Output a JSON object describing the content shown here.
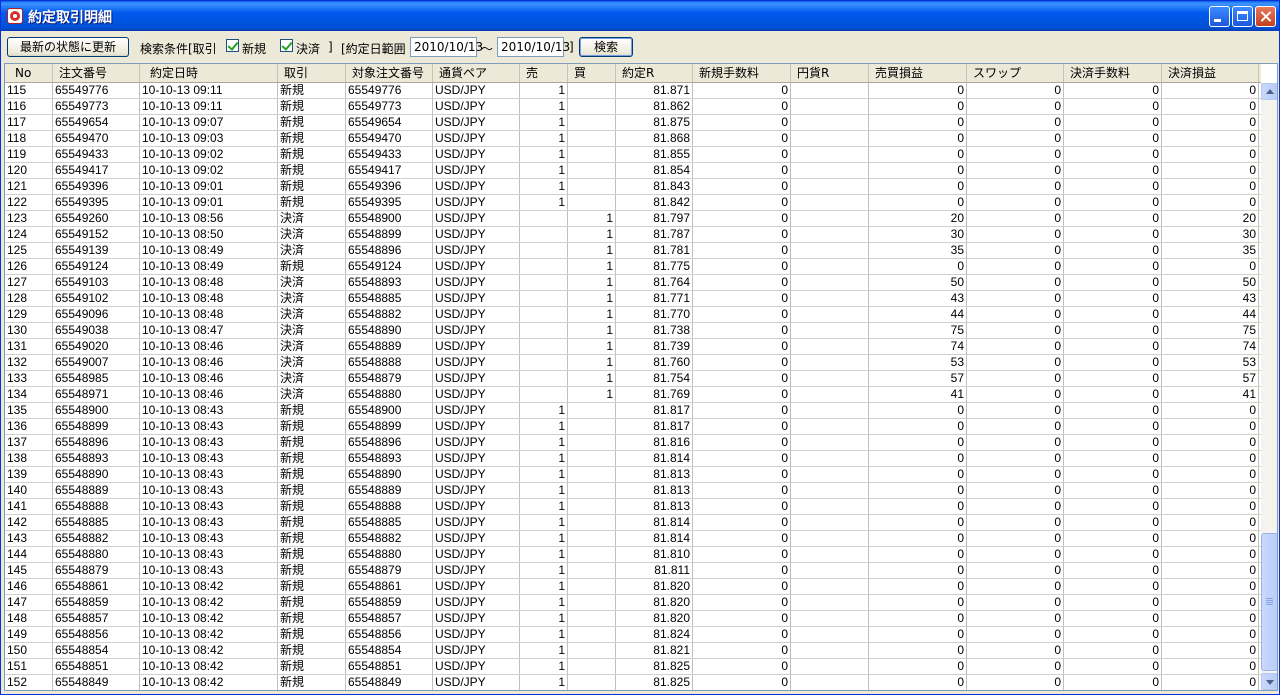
{
  "window": {
    "title": "約定取引明細"
  },
  "toolbar": {
    "refresh_label": "最新の状態に更新",
    "search_cond_label": "検索条件[取引",
    "new_label": "新規",
    "settle_label": "決済",
    "bracket_close": "]",
    "date_range_label": "[約定日範囲",
    "date_from": "2010/10/13",
    "tilde": "～",
    "date_to": "2010/10/13",
    "bracket_close2": "]",
    "search_label": "検索"
  },
  "table": {
    "columns": [
      "No",
      "注文番号",
      "約定日時",
      "取引",
      "対象注文番号",
      "通貨ペア",
      "売",
      "買",
      "約定R",
      "新規手数料",
      "円貨R",
      "売買損益",
      "スワップ",
      "決済手数料",
      "決済損益"
    ],
    "rows": [
      [
        "115",
        "65549776",
        "10-10-13 09:11",
        "新規",
        "65549776",
        "USD/JPY",
        "1",
        "",
        "81.871",
        "0",
        "",
        "0",
        "0",
        "0",
        "0"
      ],
      [
        "116",
        "65549773",
        "10-10-13 09:11",
        "新規",
        "65549773",
        "USD/JPY",
        "1",
        "",
        "81.862",
        "0",
        "",
        "0",
        "0",
        "0",
        "0"
      ],
      [
        "117",
        "65549654",
        "10-10-13 09:07",
        "新規",
        "65549654",
        "USD/JPY",
        "1",
        "",
        "81.875",
        "0",
        "",
        "0",
        "0",
        "0",
        "0"
      ],
      [
        "118",
        "65549470",
        "10-10-13 09:03",
        "新規",
        "65549470",
        "USD/JPY",
        "1",
        "",
        "81.868",
        "0",
        "",
        "0",
        "0",
        "0",
        "0"
      ],
      [
        "119",
        "65549433",
        "10-10-13 09:02",
        "新規",
        "65549433",
        "USD/JPY",
        "1",
        "",
        "81.855",
        "0",
        "",
        "0",
        "0",
        "0",
        "0"
      ],
      [
        "120",
        "65549417",
        "10-10-13 09:02",
        "新規",
        "65549417",
        "USD/JPY",
        "1",
        "",
        "81.854",
        "0",
        "",
        "0",
        "0",
        "0",
        "0"
      ],
      [
        "121",
        "65549396",
        "10-10-13 09:01",
        "新規",
        "65549396",
        "USD/JPY",
        "1",
        "",
        "81.843",
        "0",
        "",
        "0",
        "0",
        "0",
        "0"
      ],
      [
        "122",
        "65549395",
        "10-10-13 09:01",
        "新規",
        "65549395",
        "USD/JPY",
        "1",
        "",
        "81.842",
        "0",
        "",
        "0",
        "0",
        "0",
        "0"
      ],
      [
        "123",
        "65549260",
        "10-10-13 08:56",
        "決済",
        "65548900",
        "USD/JPY",
        "",
        "1",
        "81.797",
        "0",
        "",
        "20",
        "0",
        "0",
        "20"
      ],
      [
        "124",
        "65549152",
        "10-10-13 08:50",
        "決済",
        "65548899",
        "USD/JPY",
        "",
        "1",
        "81.787",
        "0",
        "",
        "30",
        "0",
        "0",
        "30"
      ],
      [
        "125",
        "65549139",
        "10-10-13 08:49",
        "決済",
        "65548896",
        "USD/JPY",
        "",
        "1",
        "81.781",
        "0",
        "",
        "35",
        "0",
        "0",
        "35"
      ],
      [
        "126",
        "65549124",
        "10-10-13 08:49",
        "新規",
        "65549124",
        "USD/JPY",
        "",
        "1",
        "81.775",
        "0",
        "",
        "0",
        "0",
        "0",
        "0"
      ],
      [
        "127",
        "65549103",
        "10-10-13 08:48",
        "決済",
        "65548893",
        "USD/JPY",
        "",
        "1",
        "81.764",
        "0",
        "",
        "50",
        "0",
        "0",
        "50"
      ],
      [
        "128",
        "65549102",
        "10-10-13 08:48",
        "決済",
        "65548885",
        "USD/JPY",
        "",
        "1",
        "81.771",
        "0",
        "",
        "43",
        "0",
        "0",
        "43"
      ],
      [
        "129",
        "65549096",
        "10-10-13 08:48",
        "決済",
        "65548882",
        "USD/JPY",
        "",
        "1",
        "81.770",
        "0",
        "",
        "44",
        "0",
        "0",
        "44"
      ],
      [
        "130",
        "65549038",
        "10-10-13 08:47",
        "決済",
        "65548890",
        "USD/JPY",
        "",
        "1",
        "81.738",
        "0",
        "",
        "75",
        "0",
        "0",
        "75"
      ],
      [
        "131",
        "65549020",
        "10-10-13 08:46",
        "決済",
        "65548889",
        "USD/JPY",
        "",
        "1",
        "81.739",
        "0",
        "",
        "74",
        "0",
        "0",
        "74"
      ],
      [
        "132",
        "65549007",
        "10-10-13 08:46",
        "決済",
        "65548888",
        "USD/JPY",
        "",
        "1",
        "81.760",
        "0",
        "",
        "53",
        "0",
        "0",
        "53"
      ],
      [
        "133",
        "65548985",
        "10-10-13 08:46",
        "決済",
        "65548879",
        "USD/JPY",
        "",
        "1",
        "81.754",
        "0",
        "",
        "57",
        "0",
        "0",
        "57"
      ],
      [
        "134",
        "65548971",
        "10-10-13 08:46",
        "決済",
        "65548880",
        "USD/JPY",
        "",
        "1",
        "81.769",
        "0",
        "",
        "41",
        "0",
        "0",
        "41"
      ],
      [
        "135",
        "65548900",
        "10-10-13 08:43",
        "新規",
        "65548900",
        "USD/JPY",
        "1",
        "",
        "81.817",
        "0",
        "",
        "0",
        "0",
        "0",
        "0"
      ],
      [
        "136",
        "65548899",
        "10-10-13 08:43",
        "新規",
        "65548899",
        "USD/JPY",
        "1",
        "",
        "81.817",
        "0",
        "",
        "0",
        "0",
        "0",
        "0"
      ],
      [
        "137",
        "65548896",
        "10-10-13 08:43",
        "新規",
        "65548896",
        "USD/JPY",
        "1",
        "",
        "81.816",
        "0",
        "",
        "0",
        "0",
        "0",
        "0"
      ],
      [
        "138",
        "65548893",
        "10-10-13 08:43",
        "新規",
        "65548893",
        "USD/JPY",
        "1",
        "",
        "81.814",
        "0",
        "",
        "0",
        "0",
        "0",
        "0"
      ],
      [
        "139",
        "65548890",
        "10-10-13 08:43",
        "新規",
        "65548890",
        "USD/JPY",
        "1",
        "",
        "81.813",
        "0",
        "",
        "0",
        "0",
        "0",
        "0"
      ],
      [
        "140",
        "65548889",
        "10-10-13 08:43",
        "新規",
        "65548889",
        "USD/JPY",
        "1",
        "",
        "81.813",
        "0",
        "",
        "0",
        "0",
        "0",
        "0"
      ],
      [
        "141",
        "65548888",
        "10-10-13 08:43",
        "新規",
        "65548888",
        "USD/JPY",
        "1",
        "",
        "81.813",
        "0",
        "",
        "0",
        "0",
        "0",
        "0"
      ],
      [
        "142",
        "65548885",
        "10-10-13 08:43",
        "新規",
        "65548885",
        "USD/JPY",
        "1",
        "",
        "81.814",
        "0",
        "",
        "0",
        "0",
        "0",
        "0"
      ],
      [
        "143",
        "65548882",
        "10-10-13 08:43",
        "新規",
        "65548882",
        "USD/JPY",
        "1",
        "",
        "81.814",
        "0",
        "",
        "0",
        "0",
        "0",
        "0"
      ],
      [
        "144",
        "65548880",
        "10-10-13 08:43",
        "新規",
        "65548880",
        "USD/JPY",
        "1",
        "",
        "81.810",
        "0",
        "",
        "0",
        "0",
        "0",
        "0"
      ],
      [
        "145",
        "65548879",
        "10-10-13 08:43",
        "新規",
        "65548879",
        "USD/JPY",
        "1",
        "",
        "81.811",
        "0",
        "",
        "0",
        "0",
        "0",
        "0"
      ],
      [
        "146",
        "65548861",
        "10-10-13 08:42",
        "新規",
        "65548861",
        "USD/JPY",
        "1",
        "",
        "81.820",
        "0",
        "",
        "0",
        "0",
        "0",
        "0"
      ],
      [
        "147",
        "65548859",
        "10-10-13 08:42",
        "新規",
        "65548859",
        "USD/JPY",
        "1",
        "",
        "81.820",
        "0",
        "",
        "0",
        "0",
        "0",
        "0"
      ],
      [
        "148",
        "65548857",
        "10-10-13 08:42",
        "新規",
        "65548857",
        "USD/JPY",
        "1",
        "",
        "81.820",
        "0",
        "",
        "0",
        "0",
        "0",
        "0"
      ],
      [
        "149",
        "65548856",
        "10-10-13 08:42",
        "新規",
        "65548856",
        "USD/JPY",
        "1",
        "",
        "81.824",
        "0",
        "",
        "0",
        "0",
        "0",
        "0"
      ],
      [
        "150",
        "65548854",
        "10-10-13 08:42",
        "新規",
        "65548854",
        "USD/JPY",
        "1",
        "",
        "81.821",
        "0",
        "",
        "0",
        "0",
        "0",
        "0"
      ],
      [
        "151",
        "65548851",
        "10-10-13 08:42",
        "新規",
        "65548851",
        "USD/JPY",
        "1",
        "",
        "81.825",
        "0",
        "",
        "0",
        "0",
        "0",
        "0"
      ],
      [
        "152",
        "65548849",
        "10-10-13 08:42",
        "新規",
        "65548849",
        "USD/JPY",
        "1",
        "",
        "81.825",
        "0",
        "",
        "0",
        "0",
        "0",
        "0"
      ]
    ]
  }
}
